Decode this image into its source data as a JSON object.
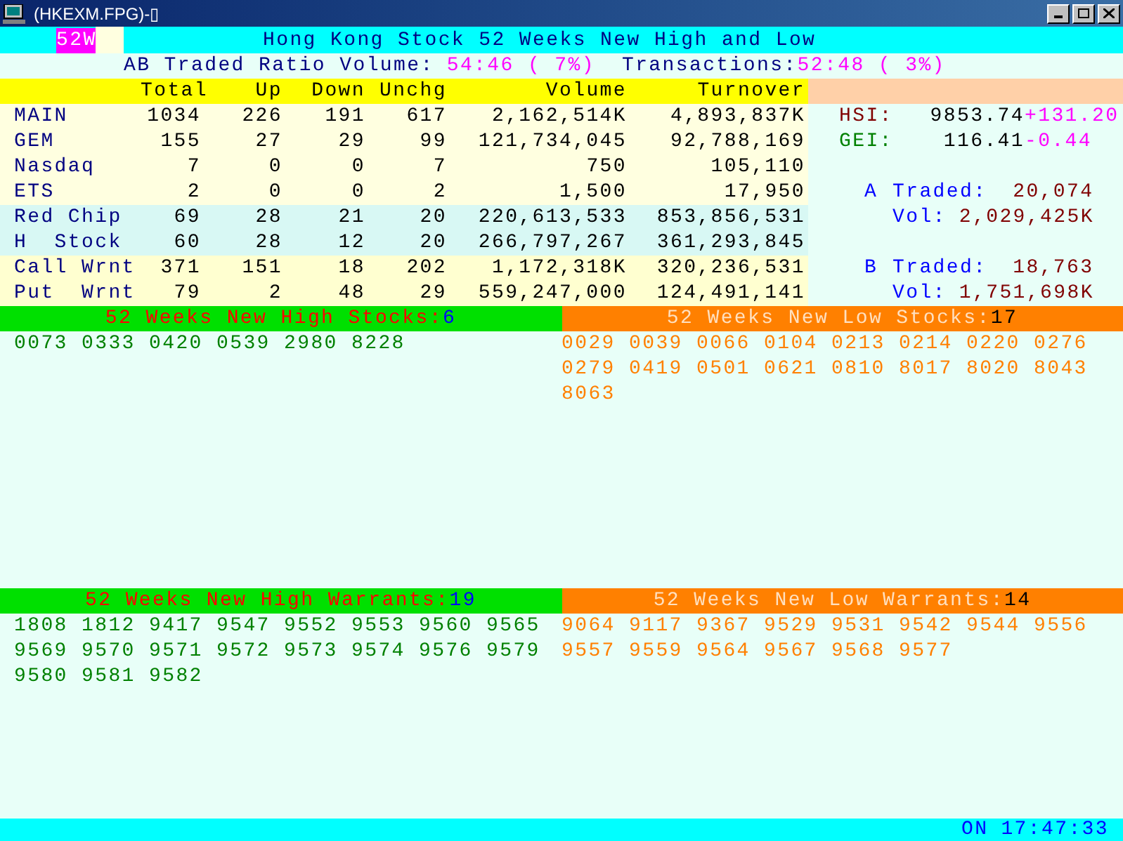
{
  "window": {
    "title": "(HKEXM.FPG)-▯"
  },
  "banner": {
    "badge": "52W",
    "title": "Hong Kong Stock 52 Weeks New High and Low"
  },
  "ratio_line": {
    "label": "AB Traded Ratio Volume:",
    "volume_ratio": "54:46 ( 7%)",
    "transactions_label": "Transactions:",
    "transactions_ratio": "52:48 ( 3%)"
  },
  "table": {
    "columns": [
      "Total",
      "Up",
      "Down",
      "Unchg",
      "Volume",
      "Turnover"
    ],
    "rows": [
      {
        "name": "MAIN",
        "kind": "board",
        "cells": [
          "1034",
          "226",
          "191",
          "617",
          "2,162,514K",
          "4,893,837K"
        ]
      },
      {
        "name": "GEM",
        "kind": "board",
        "cells": [
          "155",
          "27",
          "29",
          "99",
          "121,734,045",
          "92,788,169"
        ]
      },
      {
        "name": "Nasdaq",
        "kind": "board",
        "cells": [
          "7",
          "0",
          "0",
          "7",
          "750",
          "105,110"
        ]
      },
      {
        "name": "ETS",
        "kind": "board",
        "cells": [
          "2",
          "0",
          "0",
          "2",
          "1,500",
          "17,950"
        ]
      },
      {
        "name": "Red Chip",
        "kind": "china",
        "cells": [
          "69",
          "28",
          "21",
          "20",
          "220,613,533",
          "853,856,531"
        ]
      },
      {
        "name": "H  Stock",
        "kind": "china",
        "cells": [
          "60",
          "28",
          "12",
          "20",
          "266,797,267",
          "361,293,845"
        ]
      },
      {
        "name": "Call Wrnt",
        "kind": "warrant",
        "cells": [
          "371",
          "151",
          "18",
          "202",
          "1,172,318K",
          "320,236,531"
        ]
      },
      {
        "name": "Put  Wrnt",
        "kind": "warrant",
        "cells": [
          "79",
          "2",
          "48",
          "29",
          "559,247,000",
          "124,491,141"
        ]
      }
    ]
  },
  "indices": [
    {
      "name": "HSI:",
      "value": "9853.74",
      "change": "+131.20",
      "color": "#800000"
    },
    {
      "name": "GEI:",
      "value": "116.41",
      "change": "-0.44",
      "color": "#008000"
    }
  ],
  "brokers": [
    {
      "side": "A",
      "traded_label": "Traded:",
      "traded": "20,074",
      "vol_label": "Vol:",
      "vol": "2,029,425K"
    },
    {
      "side": "B",
      "traded_label": "Traded:",
      "traded": "18,763",
      "vol_label": "Vol:",
      "vol": "1,751,698K"
    }
  ],
  "sections": [
    {
      "kind": "high",
      "title": "52 Weeks New High Stocks:",
      "count": "6",
      "codes": [
        "0073",
        "0333",
        "0420",
        "0539",
        "2980",
        "8228"
      ]
    },
    {
      "kind": "low",
      "title": "52 Weeks New Low Stocks:",
      "count": "17",
      "codes": [
        "0029",
        "0039",
        "0066",
        "0104",
        "0213",
        "0214",
        "0220",
        "0276",
        "0279",
        "0419",
        "0501",
        "0621",
        "0810",
        "8017",
        "8020",
        "8043",
        "8063"
      ]
    },
    {
      "kind": "high",
      "title": "52 Weeks New High Warrants:",
      "count": "19",
      "codes": [
        "1808",
        "1812",
        "9417",
        "9547",
        "9552",
        "9553",
        "9560",
        "9565",
        "9569",
        "9570",
        "9571",
        "9572",
        "9573",
        "9574",
        "9576",
        "9579",
        "9580",
        "9581",
        "9582"
      ]
    },
    {
      "kind": "low",
      "title": "52 Weeks New Low Warrants:",
      "count": "14",
      "codes": [
        "9064",
        "9117",
        "9367",
        "9529",
        "9531",
        "9542",
        "9544",
        "9556",
        "9557",
        "9559",
        "9564",
        "9567",
        "9568",
        "9577"
      ]
    }
  ],
  "status_bar": {
    "state": "ON",
    "time": "17:47:33"
  }
}
